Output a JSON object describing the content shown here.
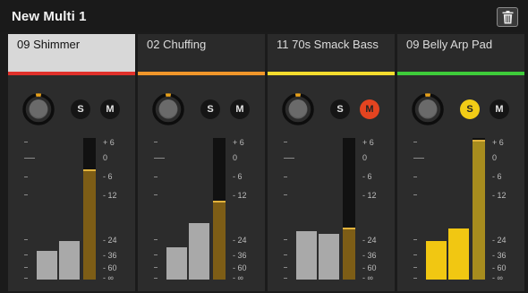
{
  "title": "New Multi 1",
  "colors": {
    "background": "#1b1b1b",
    "strip": "#2c2c2c",
    "selected_header": "#d8d8d8",
    "knob_accent": "#e8a11a",
    "solo_active": "#f2cc16",
    "mute_active": "#e44420",
    "meter_fill": "#7d5d16",
    "meter_peak": "#e2b33c",
    "output_bar_gray": "#a9a9a9",
    "output_bar_yellow": "#f1c712"
  },
  "scale_labels": [
    "+ 6",
    "0",
    "- 6",
    "- 12",
    "- 24",
    "- 36",
    "- 60",
    "- ∞"
  ],
  "strips": [
    {
      "name": "09 Shimmer",
      "selected": true,
      "accent": "#e0312b",
      "solo_label": "S",
      "mute_label": "M",
      "solo_on": false,
      "mute_on": false,
      "meter_level": 0.78,
      "output_levels": [
        0.2,
        0.27
      ],
      "output_color": "gray"
    },
    {
      "name": "02 Chuffing",
      "selected": false,
      "accent": "#f0962a",
      "solo_label": "S",
      "mute_label": "M",
      "solo_on": false,
      "mute_on": false,
      "meter_level": 0.56,
      "output_levels": [
        0.23,
        0.4
      ],
      "output_color": "gray"
    },
    {
      "name": "11 70s Smack Bass",
      "selected": false,
      "accent": "#f4dc2e",
      "solo_label": "S",
      "mute_label": "M",
      "solo_on": false,
      "mute_on": true,
      "meter_level": 0.37,
      "output_levels": [
        0.34,
        0.32
      ],
      "output_color": "gray"
    },
    {
      "name": "09 Belly Arp Pad",
      "selected": false,
      "accent": "#3ecc3a",
      "solo_label": "S",
      "mute_label": "M",
      "solo_on": true,
      "mute_on": false,
      "meter_level": 0.99,
      "output_levels": [
        0.27,
        0.36
      ],
      "output_color": "yellow"
    }
  ]
}
